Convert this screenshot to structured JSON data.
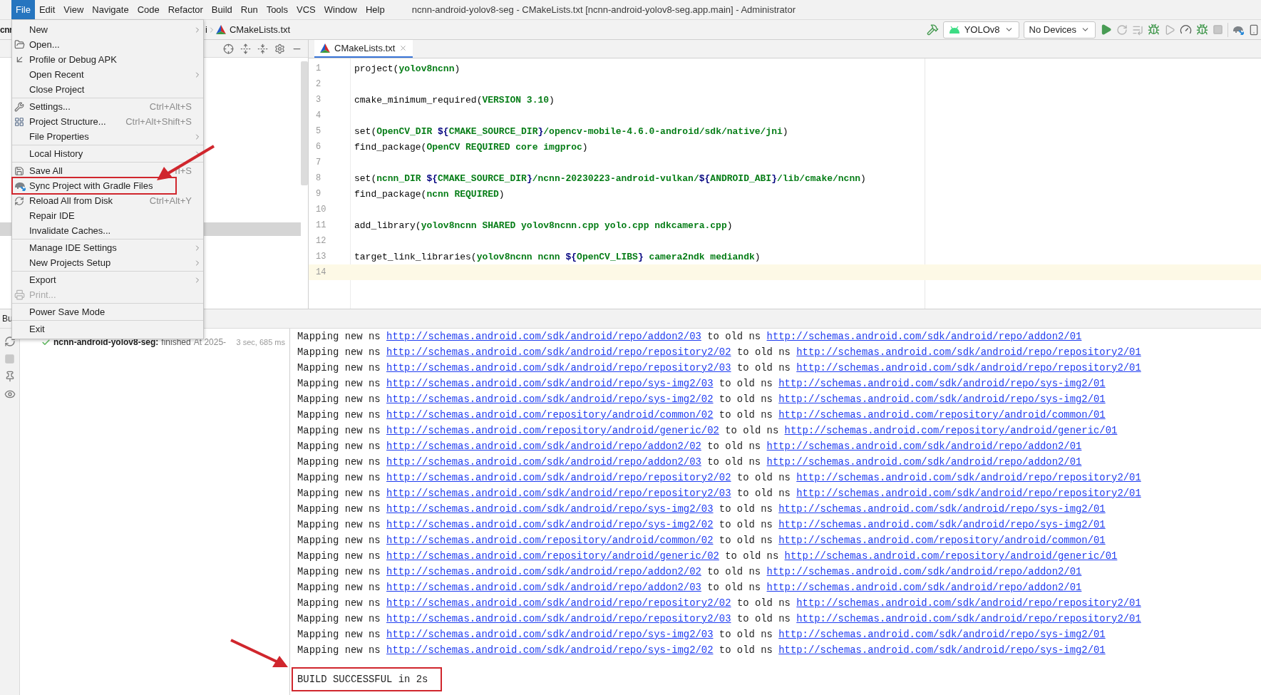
{
  "menu_bar": {
    "items": [
      {
        "label": "File",
        "selected": true
      },
      {
        "label": "Edit",
        "selected": false
      },
      {
        "label": "View",
        "selected": false
      },
      {
        "label": "Navigate",
        "selected": false
      },
      {
        "label": "Code",
        "selected": false
      },
      {
        "label": "Refactor",
        "selected": false
      },
      {
        "label": "Build",
        "selected": false
      },
      {
        "label": "Run",
        "selected": false
      },
      {
        "label": "Tools",
        "selected": false
      },
      {
        "label": "VCS",
        "selected": false
      },
      {
        "label": "Window",
        "selected": false
      },
      {
        "label": "Help",
        "selected": false
      }
    ],
    "title": "ncnn-android-yolov8-seg - CMakeLists.txt [ncnn-android-yolov8-seg.app.main] - Administrator"
  },
  "navigation_bar": {
    "breadcrumbs": [
      "cnr",
      "i",
      "CMakeLists.txt"
    ],
    "run_configuration": "YOLOv8",
    "device": "No Devices"
  },
  "file_menu": {
    "sections": [
      [
        {
          "label": "New",
          "submenu": true,
          "disabled": false,
          "annotated": false
        },
        {
          "label": "Open...",
          "submenu": false,
          "disabled": false,
          "annotated": false
        },
        {
          "label": "Profile or Debug APK",
          "submenu": false,
          "disabled": false,
          "annotated": false
        },
        {
          "label": "Open Recent",
          "submenu": true,
          "disabled": false,
          "annotated": false
        },
        {
          "label": "Close Project",
          "submenu": false,
          "disabled": false,
          "annotated": false
        }
      ],
      [
        {
          "label": "Settings...",
          "shortcut": "Ctrl+Alt+S",
          "submenu": false,
          "disabled": false,
          "annotated": false
        },
        {
          "label": "Project Structure...",
          "shortcut": "Ctrl+Alt+Shift+S",
          "submenu": false,
          "disabled": false,
          "annotated": false
        },
        {
          "label": "File Properties",
          "submenu": true,
          "disabled": false,
          "annotated": false
        }
      ],
      [
        {
          "label": "Local History",
          "submenu": true,
          "disabled": false,
          "annotated": false
        }
      ],
      [
        {
          "label": "Save All",
          "shortcut": "rl+S",
          "submenu": false,
          "disabled": false,
          "annotated": false
        },
        {
          "label": "Sync Project with Gradle Files",
          "submenu": false,
          "disabled": false,
          "annotated": true
        },
        {
          "label": "Reload All from Disk",
          "shortcut": "Ctrl+Alt+Y",
          "submenu": false,
          "disabled": false,
          "annotated": false
        },
        {
          "label": "Repair IDE",
          "submenu": false,
          "disabled": false,
          "annotated": false
        },
        {
          "label": "Invalidate Caches...",
          "submenu": false,
          "disabled": false,
          "annotated": false
        }
      ],
      [
        {
          "label": "Manage IDE Settings",
          "submenu": true,
          "disabled": false,
          "annotated": false
        },
        {
          "label": "New Projects Setup",
          "submenu": true,
          "disabled": false,
          "annotated": false
        }
      ],
      [
        {
          "label": "Export",
          "submenu": true,
          "disabled": false,
          "annotated": false
        },
        {
          "label": "Print...",
          "submenu": false,
          "disabled": true,
          "annotated": false
        }
      ],
      [
        {
          "label": "Power Save Mode",
          "submenu": false,
          "disabled": false,
          "annotated": false
        }
      ],
      [
        {
          "label": "Exit",
          "submenu": false,
          "disabled": false,
          "annotated": false
        }
      ]
    ]
  },
  "editor": {
    "tabs": [
      {
        "label": "CMakeLists.txt",
        "selected": true
      }
    ],
    "lines": [
      {
        "number": "1",
        "current": false,
        "segments": [
          {
            "text": "project(",
            "kind": "plain"
          },
          {
            "text": "yolov8ncnn",
            "kind": "arg"
          },
          {
            "text": ")",
            "kind": "plain"
          }
        ]
      },
      {
        "number": "2",
        "current": false
      },
      {
        "number": "3",
        "current": false,
        "segments": [
          {
            "text": "cmake_minimum_required(",
            "kind": "plain"
          },
          {
            "text": "VERSION 3.10",
            "kind": "arg"
          },
          {
            "text": ")",
            "kind": "plain"
          }
        ]
      },
      {
        "number": "4",
        "current": false
      },
      {
        "number": "5",
        "current": false,
        "segments": [
          {
            "text": "set(",
            "kind": "plain"
          },
          {
            "text": "OpenCV_DIR ",
            "kind": "arg"
          },
          {
            "text": "${",
            "kind": "var"
          },
          {
            "text": "CMAKE_SOURCE_DIR",
            "kind": "arg"
          },
          {
            "text": "}",
            "kind": "var"
          },
          {
            "text": "/opencv-mobile-4.6.0-android/sdk/native/jni",
            "kind": "arg"
          },
          {
            "text": ")",
            "kind": "plain"
          }
        ]
      },
      {
        "number": "6",
        "current": false,
        "segments": [
          {
            "text": "find_package(",
            "kind": "plain"
          },
          {
            "text": "OpenCV REQUIRED core imgproc",
            "kind": "arg"
          },
          {
            "text": ")",
            "kind": "plain"
          }
        ]
      },
      {
        "number": "7",
        "current": false
      },
      {
        "number": "8",
        "current": false,
        "segments": [
          {
            "text": "set(",
            "kind": "plain"
          },
          {
            "text": "ncnn_DIR ",
            "kind": "arg"
          },
          {
            "text": "${",
            "kind": "var"
          },
          {
            "text": "CMAKE_SOURCE_DIR",
            "kind": "arg"
          },
          {
            "text": "}",
            "kind": "var"
          },
          {
            "text": "/ncnn-20230223-android-vulkan/",
            "kind": "arg"
          },
          {
            "text": "${",
            "kind": "var"
          },
          {
            "text": "ANDROID_ABI",
            "kind": "arg"
          },
          {
            "text": "}",
            "kind": "var"
          },
          {
            "text": "/lib/cmake/ncnn",
            "kind": "arg"
          },
          {
            "text": ")",
            "kind": "plain"
          }
        ]
      },
      {
        "number": "9",
        "current": false,
        "segments": [
          {
            "text": "find_package(",
            "kind": "plain"
          },
          {
            "text": "ncnn REQUIRED",
            "kind": "arg"
          },
          {
            "text": ")",
            "kind": "plain"
          }
        ]
      },
      {
        "number": "10",
        "current": false
      },
      {
        "number": "11",
        "current": false,
        "segments": [
          {
            "text": "add_library(",
            "kind": "plain"
          },
          {
            "text": "yolov8ncnn SHARED yolov8ncnn.cpp yolo.cpp ndkcamera.cpp",
            "kind": "arg"
          },
          {
            "text": ")",
            "kind": "plain"
          }
        ]
      },
      {
        "number": "12",
        "current": false
      },
      {
        "number": "13",
        "current": false,
        "segments": [
          {
            "text": "target_link_libraries(",
            "kind": "plain"
          },
          {
            "text": "yolov8ncnn ncnn ",
            "kind": "arg"
          },
          {
            "text": "${",
            "kind": "var"
          },
          {
            "text": "OpenCV_LIBS",
            "kind": "arg"
          },
          {
            "text": "}",
            "kind": "var"
          },
          {
            "text": " camera2ndk mediandk",
            "kind": "arg"
          },
          {
            "text": ")",
            "kind": "plain"
          }
        ]
      },
      {
        "number": "14",
        "current": true
      }
    ]
  },
  "build_panel": {
    "title": "Bu",
    "tree": [
      {
        "name": "ncnn-android-yolov8-seg:",
        "status": "finished",
        "started": "At 2025-",
        "duration": "3 sec, 685 ms"
      }
    ],
    "console": {
      "lines": [
        {
          "lead": "Mapping new ns",
          "new_ns": "http://schemas.android.com/sdk/android/repo/addon2/03",
          "mid": "to old ns",
          "old_ns": "http://schemas.android.com/sdk/android/repo/addon2/01"
        },
        {
          "lead": "Mapping new ns",
          "new_ns": "http://schemas.android.com/sdk/android/repo/repository2/02",
          "mid": "to old ns",
          "old_ns": "http://schemas.android.com/sdk/android/repo/repository2/01"
        },
        {
          "lead": "Mapping new ns",
          "new_ns": "http://schemas.android.com/sdk/android/repo/repository2/03",
          "mid": "to old ns",
          "old_ns": "http://schemas.android.com/sdk/android/repo/repository2/01"
        },
        {
          "lead": "Mapping new ns",
          "new_ns": "http://schemas.android.com/sdk/android/repo/sys-img2/03",
          "mid": "to old ns",
          "old_ns": "http://schemas.android.com/sdk/android/repo/sys-img2/01"
        },
        {
          "lead": "Mapping new ns",
          "new_ns": "http://schemas.android.com/sdk/android/repo/sys-img2/02",
          "mid": "to old ns",
          "old_ns": "http://schemas.android.com/sdk/android/repo/sys-img2/01"
        },
        {
          "lead": "Mapping new ns",
          "new_ns": "http://schemas.android.com/repository/android/common/02",
          "mid": "to old ns",
          "old_ns": "http://schemas.android.com/repository/android/common/01"
        },
        {
          "lead": "Mapping new ns",
          "new_ns": "http://schemas.android.com/repository/android/generic/02",
          "mid": "to old ns",
          "old_ns": "http://schemas.android.com/repository/android/generic/01"
        },
        {
          "lead": "Mapping new ns",
          "new_ns": "http://schemas.android.com/sdk/android/repo/addon2/02",
          "mid": "to old ns",
          "old_ns": "http://schemas.android.com/sdk/android/repo/addon2/01"
        },
        {
          "lead": "Mapping new ns",
          "new_ns": "http://schemas.android.com/sdk/android/repo/addon2/03",
          "mid": "to old ns",
          "old_ns": "http://schemas.android.com/sdk/android/repo/addon2/01"
        },
        {
          "lead": "Mapping new ns",
          "new_ns": "http://schemas.android.com/sdk/android/repo/repository2/02",
          "mid": "to old ns",
          "old_ns": "http://schemas.android.com/sdk/android/repo/repository2/01"
        },
        {
          "lead": "Mapping new ns",
          "new_ns": "http://schemas.android.com/sdk/android/repo/repository2/03",
          "mid": "to old ns",
          "old_ns": "http://schemas.android.com/sdk/android/repo/repository2/01"
        },
        {
          "lead": "Mapping new ns",
          "new_ns": "http://schemas.android.com/sdk/android/repo/sys-img2/03",
          "mid": "to old ns",
          "old_ns": "http://schemas.android.com/sdk/android/repo/sys-img2/01"
        },
        {
          "lead": "Mapping new ns",
          "new_ns": "http://schemas.android.com/sdk/android/repo/sys-img2/02",
          "mid": "to old ns",
          "old_ns": "http://schemas.android.com/sdk/android/repo/sys-img2/01"
        },
        {
          "lead": "Mapping new ns",
          "new_ns": "http://schemas.android.com/repository/android/common/02",
          "mid": "to old ns",
          "old_ns": "http://schemas.android.com/repository/android/common/01"
        },
        {
          "lead": "Mapping new ns",
          "new_ns": "http://schemas.android.com/repository/android/generic/02",
          "mid": "to old ns",
          "old_ns": "http://schemas.android.com/repository/android/generic/01"
        },
        {
          "lead": "Mapping new ns",
          "new_ns": "http://schemas.android.com/sdk/android/repo/addon2/02",
          "mid": "to old ns",
          "old_ns": "http://schemas.android.com/sdk/android/repo/addon2/01"
        },
        {
          "lead": "Mapping new ns",
          "new_ns": "http://schemas.android.com/sdk/android/repo/addon2/03",
          "mid": "to old ns",
          "old_ns": "http://schemas.android.com/sdk/android/repo/addon2/01"
        },
        {
          "lead": "Mapping new ns",
          "new_ns": "http://schemas.android.com/sdk/android/repo/repository2/02",
          "mid": "to old ns",
          "old_ns": "http://schemas.android.com/sdk/android/repo/repository2/01"
        },
        {
          "lead": "Mapping new ns",
          "new_ns": "http://schemas.android.com/sdk/android/repo/repository2/03",
          "mid": "to old ns",
          "old_ns": "http://schemas.android.com/sdk/android/repo/repository2/01"
        },
        {
          "lead": "Mapping new ns",
          "new_ns": "http://schemas.android.com/sdk/android/repo/sys-img2/03",
          "mid": "to old ns",
          "old_ns": "http://schemas.android.com/sdk/android/repo/sys-img2/01"
        },
        {
          "lead": "Mapping new ns",
          "new_ns": "http://schemas.android.com/sdk/android/repo/sys-img2/02",
          "mid": "to old ns",
          "old_ns": "http://schemas.android.com/sdk/android/repo/sys-img2/01"
        }
      ],
      "result": "BUILD SUCCESSFUL in 2s"
    }
  }
}
